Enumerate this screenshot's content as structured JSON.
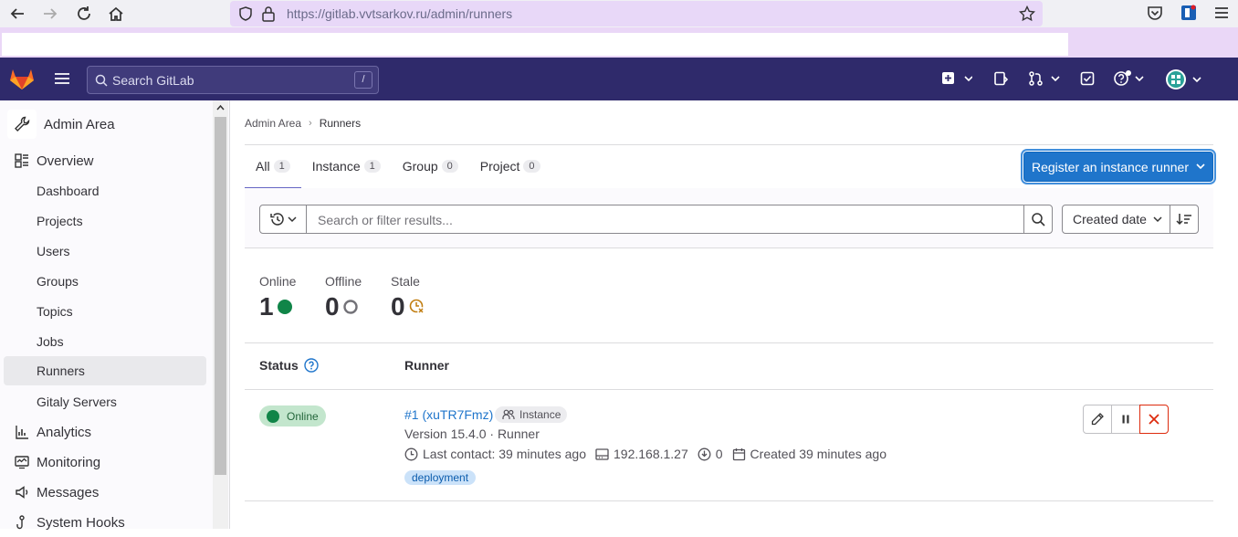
{
  "browser": {
    "url": "https://gitlab.vvtsarkov.ru/admin/runners"
  },
  "topbar": {
    "search_placeholder": "Search GitLab",
    "search_shortcut": "/"
  },
  "sidebar": {
    "title": "Admin Area",
    "items": [
      {
        "label": "Overview",
        "icon": "overview-icon",
        "top": true
      },
      {
        "label": "Dashboard"
      },
      {
        "label": "Projects"
      },
      {
        "label": "Users"
      },
      {
        "label": "Groups"
      },
      {
        "label": "Topics"
      },
      {
        "label": "Jobs"
      },
      {
        "label": "Runners",
        "active": true
      },
      {
        "label": "Gitaly Servers"
      },
      {
        "label": "Analytics",
        "icon": "analytics-icon",
        "top": true
      },
      {
        "label": "Monitoring",
        "icon": "monitoring-icon",
        "top": true
      },
      {
        "label": "Messages",
        "icon": "messages-icon",
        "top": true
      },
      {
        "label": "System Hooks",
        "icon": "hook-icon",
        "top": true
      }
    ]
  },
  "breadcrumb": {
    "parent": "Admin Area",
    "current": "Runners"
  },
  "tabs": [
    {
      "label": "All",
      "count": "1"
    },
    {
      "label": "Instance",
      "count": "1"
    },
    {
      "label": "Group",
      "count": "0"
    },
    {
      "label": "Project",
      "count": "0"
    }
  ],
  "register_button": "Register an instance runner",
  "filter": {
    "placeholder": "Search or filter results...",
    "sort": "Created date"
  },
  "stats": [
    {
      "label": "Online",
      "value": "1"
    },
    {
      "label": "Offline",
      "value": "0"
    },
    {
      "label": "Stale",
      "value": "0"
    }
  ],
  "table": {
    "col_status": "Status",
    "col_runner": "Runner"
  },
  "runner": {
    "status": "Online",
    "name": "#1 (xuTR7Fmz)",
    "type": "Instance",
    "version": "Version 15.4.0 · Runner",
    "last_contact": "Last contact: 39 minutes ago",
    "ip": "192.168.1.27",
    "jobs": "0",
    "created": "Created 39 minutes ago",
    "tag": "deployment"
  },
  "colors": {
    "topbar": "#2f2a6b",
    "accent": "#1f75cb",
    "online": "#108548",
    "danger": "#dd2b0e"
  }
}
